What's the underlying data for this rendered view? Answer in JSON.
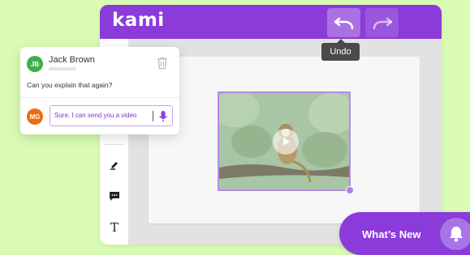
{
  "app": {
    "logo": "kami",
    "toolbar": {
      "undo_icon": "undo-icon",
      "redo_icon": "redo-icon",
      "undo_tooltip": "Undo"
    },
    "sidebar_tools": [
      "highlighter-icon",
      "comment-icon",
      "text-icon"
    ],
    "text_tool_glyph": "T"
  },
  "comment": {
    "author_initials": "JB",
    "author_name": "Jack Brown",
    "text": "Can you explain that again?",
    "reply_initials": "MG",
    "reply_text": "Sure, I can send you a video"
  },
  "whats_new": {
    "label": "What’s New"
  },
  "colors": {
    "background": "#d9fbb4",
    "brand": "#8a3bd9",
    "avatar_jb": "#3fae4a",
    "avatar_mg": "#f06a10",
    "reply_text": "#7b35c8"
  }
}
